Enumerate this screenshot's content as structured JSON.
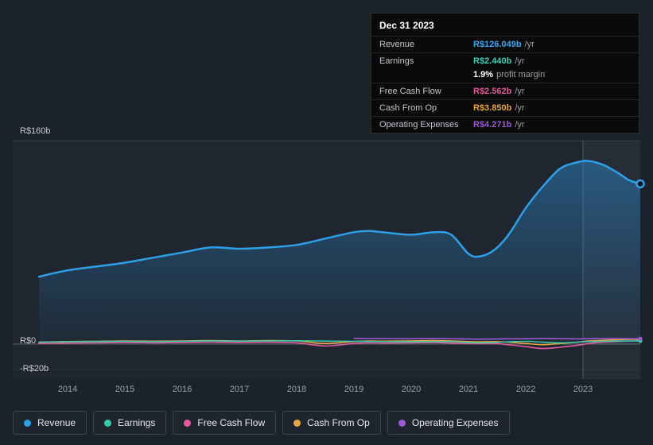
{
  "tooltip": {
    "date": "Dec 31 2023",
    "rows": [
      {
        "label": "Revenue",
        "value": "R$126.049b",
        "suffix": "/yr",
        "color": "#3aa7f0"
      },
      {
        "label": "Earnings",
        "value": "R$2.440b",
        "suffix": "/yr",
        "color": "#3ecfb0"
      },
      {
        "label": "",
        "value": "1.9%",
        "suffix": "profit margin",
        "color": "#ffffff"
      },
      {
        "label": "Free Cash Flow",
        "value": "R$2.562b",
        "suffix": "/yr",
        "color": "#e25a9d"
      },
      {
        "label": "Cash From Op",
        "value": "R$3.850b",
        "suffix": "/yr",
        "color": "#e9a440"
      },
      {
        "label": "Operating Expenses",
        "value": "R$4.271b",
        "suffix": "/yr",
        "color": "#9b59d6"
      }
    ]
  },
  "axis": {
    "y_top": "R$160b",
    "y_zero": "R$0",
    "y_neg": "-R$20b",
    "x_ticks": [
      "2014",
      "2015",
      "2016",
      "2017",
      "2018",
      "2019",
      "2020",
      "2021",
      "2022",
      "2023"
    ]
  },
  "legend": {
    "items": [
      {
        "label": "Revenue",
        "color": "#2ea0e8"
      },
      {
        "label": "Earnings",
        "color": "#38c9a8"
      },
      {
        "label": "Free Cash Flow",
        "color": "#e25a9d"
      },
      {
        "label": "Cash From Op",
        "color": "#e9a440"
      },
      {
        "label": "Operating Expenses",
        "color": "#9b59d6"
      }
    ]
  },
  "chart_data": {
    "type": "line",
    "title": "",
    "xlabel": "",
    "ylabel": "R$ billions",
    "ylim": [
      -27.5,
      160
    ],
    "xlim": [
      2013.5,
      2024
    ],
    "y_gridlines": [
      160,
      0,
      -20
    ],
    "highlight_band_start_year": 2023,
    "x": [
      2013.5,
      2014,
      2014.5,
      2015,
      2015.5,
      2016,
      2016.5,
      2017,
      2017.5,
      2018,
      2018.5,
      2019,
      2019.25,
      2019.5,
      2020,
      2020.4,
      2020.7,
      2021,
      2021.2,
      2021.45,
      2021.7,
      2022,
      2022.3,
      2022.6,
      2022.9,
      2023.1,
      2023.35,
      2023.6,
      2023.8,
      2024
    ],
    "series": [
      {
        "name": "Revenue",
        "color": "#2ea0e8",
        "area": true,
        "width": 2.5,
        "values": [
          53,
          58,
          61,
          64,
          68,
          72,
          76,
          75,
          76,
          78,
          83,
          88,
          89,
          88,
          86,
          88,
          86,
          71,
          69,
          74,
          86,
          107,
          124,
          138,
          143,
          144,
          141,
          135,
          129,
          126.049
        ]
      },
      {
        "name": "Cash From Op",
        "color": "#e9a440",
        "area": false,
        "width": 1.6,
        "values": [
          1.5,
          2.0,
          2.2,
          2.5,
          2.3,
          2.5,
          2.8,
          2.5,
          2.8,
          2.5,
          0.5,
          2.0,
          2.5,
          2.3,
          2.5,
          2.8,
          2.5,
          2.0,
          1.8,
          2.0,
          1.5,
          0.5,
          -0.5,
          0.5,
          1.5,
          2.5,
          3.0,
          3.4,
          3.7,
          3.85
        ]
      },
      {
        "name": "Free Cash Flow",
        "color": "#e25a9d",
        "area": false,
        "width": 1.6,
        "values": [
          0.5,
          0.8,
          1.0,
          1.2,
          1.0,
          1.2,
          1.5,
          1.2,
          1.5,
          1.0,
          -1.5,
          0.5,
          1.0,
          0.8,
          1.0,
          1.2,
          0.8,
          0.5,
          0.3,
          0.5,
          -0.5,
          -2.0,
          -3.5,
          -2.5,
          -1.0,
          0.5,
          1.5,
          2.0,
          2.3,
          2.562
        ]
      },
      {
        "name": "Earnings",
        "color": "#38c9a8",
        "area": false,
        "width": 1.6,
        "values": [
          1.5,
          1.8,
          2.0,
          2.2,
          2.0,
          2.2,
          2.5,
          2.3,
          2.5,
          2.6,
          2.4,
          2.2,
          2.1,
          2.0,
          1.8,
          2.0,
          1.9,
          1.2,
          1.0,
          1.3,
          1.8,
          2.2,
          1.5,
          1.0,
          1.5,
          2.0,
          2.2,
          2.3,
          2.4,
          2.44
        ]
      },
      {
        "name": "Operating Expenses",
        "color": "#9b59d6",
        "area": false,
        "width": 1.6,
        "values": [
          null,
          null,
          null,
          null,
          null,
          null,
          null,
          null,
          null,
          null,
          null,
          4.5,
          4.4,
          4.3,
          4.2,
          4.3,
          4.2,
          4.0,
          3.9,
          4.0,
          4.1,
          4.2,
          4.3,
          4.2,
          4.1,
          4.2,
          4.3,
          4.3,
          4.28,
          4.271
        ]
      }
    ]
  }
}
